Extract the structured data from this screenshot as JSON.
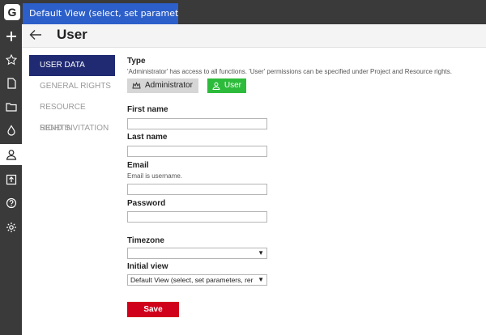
{
  "app": {
    "logo": "G"
  },
  "tab": {
    "label": "Default View (select, set parameters, r..."
  },
  "rail": {
    "icons": [
      "plus-icon",
      "star-icon",
      "document-icon",
      "folder-icon",
      "drop-icon",
      "user-icon",
      "upload-icon",
      "help-icon",
      "gear-icon"
    ],
    "active": "user-icon"
  },
  "header": {
    "title": "User"
  },
  "sidenav": {
    "items": [
      {
        "label": "USER DATA",
        "active": true
      },
      {
        "label": "GENERAL RIGHTS",
        "active": false
      },
      {
        "label": "RESOURCE RIGHTS",
        "active": false
      },
      {
        "label": "SEND INVITATION",
        "active": false
      }
    ]
  },
  "form": {
    "type_label": "Type",
    "type_hint": "'Administrator' has access to all functions. 'User' permissions can be specified under Project and Resource rights.",
    "role_admin": "Administrator",
    "role_user": "User",
    "first_name_label": "First name",
    "first_name_value": "",
    "last_name_label": "Last name",
    "last_name_value": "",
    "email_label": "Email",
    "email_hint": "Email is username.",
    "email_value": "",
    "password_label": "Password",
    "password_value": "",
    "timezone_label": "Timezone",
    "timezone_value": "",
    "initial_view_label": "Initial view",
    "initial_view_value": "Default View (select, set parameters, rer",
    "save_label": "Save"
  },
  "colors": {
    "tab": "#2c5fc9",
    "nav_active": "#1f2a72",
    "role_user": "#2dbb3b",
    "save": "#d0021b"
  }
}
